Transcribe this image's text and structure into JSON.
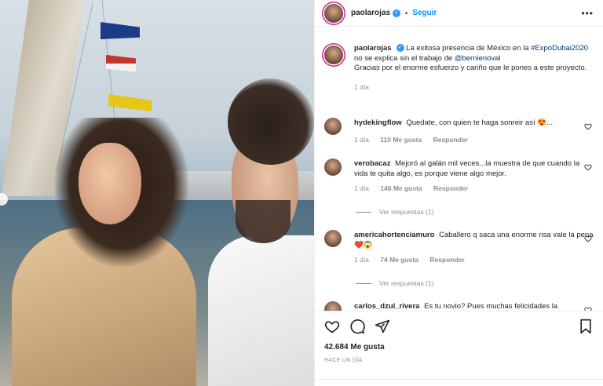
{
  "post": {
    "username": "paolarojas",
    "follow_label": "Seguir",
    "separator": "•",
    "caption_pre": "La exitosa presencia de México en la",
    "caption_hashtag": "#ExpoDubai2020",
    "caption_mid": "no se explica sin el trabajo de",
    "caption_mention": "@bernienoval",
    "caption_post": "Gracias por el enorme esfuerzo y cariño que le pones a este proyecto.",
    "caption_time": "1 día"
  },
  "comments": [
    {
      "username": "hydekingflow",
      "text": "Quedate, con quien te haga sonreir así 😍...",
      "time": "1 día",
      "likes": "110 Me gusta",
      "reply": "Responder"
    },
    {
      "username": "verobacaz",
      "text": "Mejoró al galán mil veces...la muestra de que cuando la vida te quita algo, es porque viene algo mejor.",
      "time": "1 día",
      "likes": "146 Me gusta",
      "reply": "Responder",
      "view_replies": "Ver respuestas (1)"
    },
    {
      "username": "americahortenciamuro",
      "text": "Caballero q saca una enorme risa vale la pena ❤️😱",
      "time": "1 día",
      "likes": "74 Me gusta",
      "reply": "Responder",
      "view_replies": "Ver respuestas (1)"
    },
    {
      "username": "carlos_dzul_rivera",
      "text": "Es tu novio? Pues muchas felicidades la"
    }
  ],
  "footer": {
    "likes": "42.684 Me gusta",
    "time_ago": "HACE UN DÍA"
  },
  "icons": [
    "more-icon",
    "heart-icon",
    "comment-icon",
    "share-icon",
    "bookmark-icon",
    "verified-icon"
  ],
  "colors": {
    "accent": "#0095f6",
    "verified": "#3897f0",
    "text": "#262626",
    "muted": "#8e8e8e",
    "link": "#00376b",
    "border": "#efefef"
  }
}
